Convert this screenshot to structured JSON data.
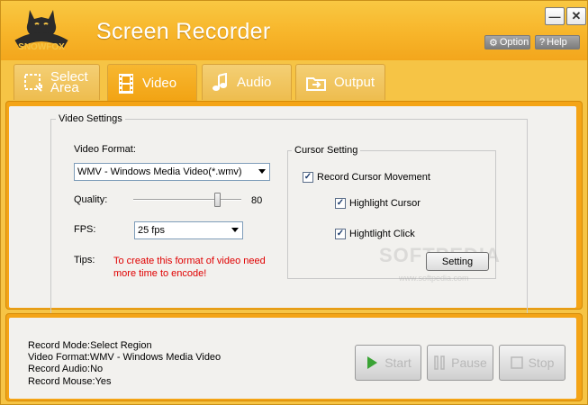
{
  "window": {
    "app_title": "Screen Recorder",
    "logo_text": "SNOWFOX",
    "minimize_label": "—",
    "close_label": "✕",
    "option_label": "Option",
    "help_label": "Help"
  },
  "tabs": [
    {
      "line1": "Select",
      "line2": "Area",
      "icon": "select-area-icon",
      "active": false
    },
    {
      "label": "Video",
      "icon": "film-icon",
      "active": true
    },
    {
      "label": "Audio",
      "icon": "music-note-icon",
      "active": false
    },
    {
      "label": "Output",
      "icon": "output-folder-icon",
      "active": false
    }
  ],
  "video_settings": {
    "group_title": "Video Settings",
    "format_label": "Video Format:",
    "format_value": "WMV - Windows Media Video(*.wmv)",
    "quality_label": "Quality:",
    "quality_value": "80",
    "quality_level": 0.8,
    "fps_label": "FPS:",
    "fps_value": "25 fps",
    "tips_label": "Tips:",
    "tips_text": "To create this format of video need more time to encode!"
  },
  "cursor_setting": {
    "group_title": "Cursor Setting",
    "record_cursor_label": "Record Cursor Movement",
    "record_cursor_checked": true,
    "highlight_cursor_label": "Highlight Cursor",
    "highlight_cursor_checked": true,
    "highlight_click_label": "Hightlight Click",
    "highlight_click_checked": true,
    "setting_button": "Setting"
  },
  "watermark": {
    "text": "SOFTPEDIA",
    "url": "www.softpedia.com"
  },
  "status": {
    "record_mode": "Record Mode:Select Region",
    "video_format": "Video Format:WMV - Windows Media Video",
    "record_audio": "Record Audio:No",
    "record_mouse": "Record Mouse:Yes"
  },
  "actions": {
    "start_label": "Start",
    "pause_label": "Pause",
    "stop_label": "Stop"
  },
  "colors": {
    "brand_orange": "#f4a416",
    "tips_red": "#e00000",
    "start_green": "#3aa335"
  }
}
